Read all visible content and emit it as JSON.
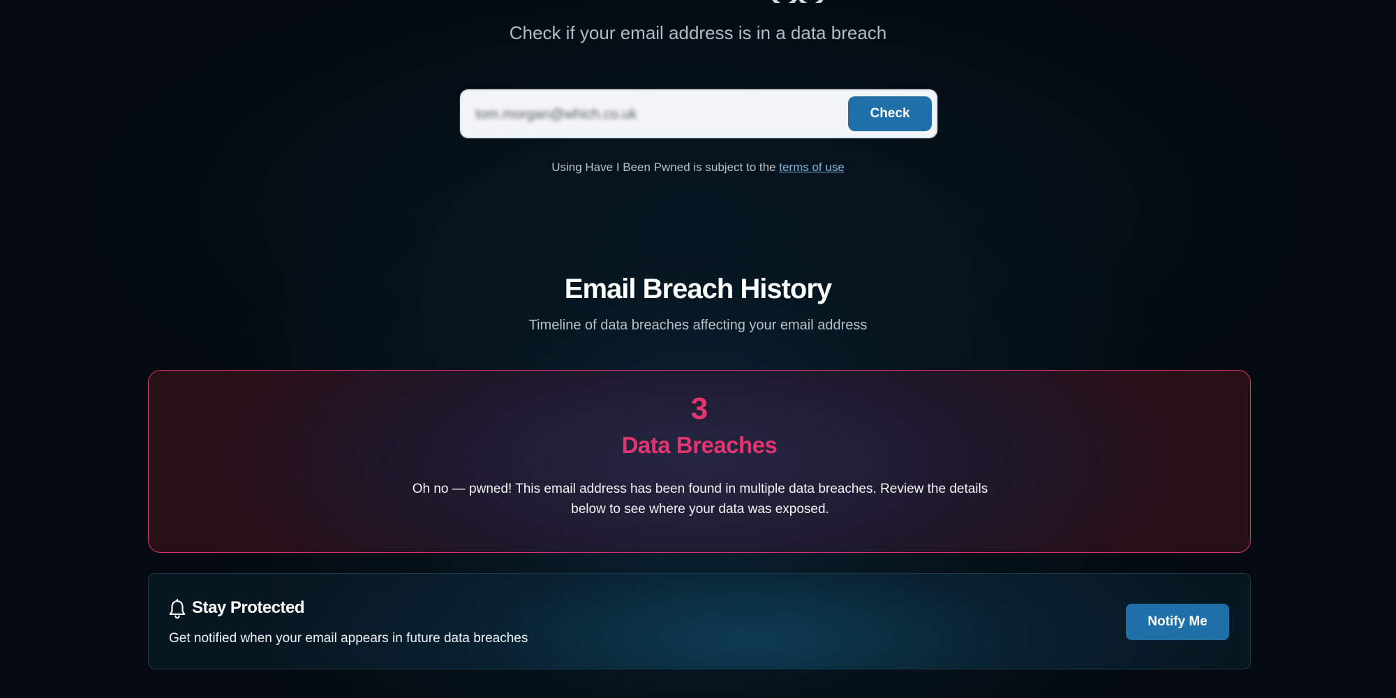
{
  "hero": {
    "subtitle": "Check if your email address is in a data breach"
  },
  "search": {
    "email_value": "tom.morgan@which.co.uk",
    "check_label": "Check"
  },
  "terms": {
    "prefix": "Using Have I Been Pwned is subject to the ",
    "link_label": "terms of use"
  },
  "history": {
    "title": "Email Breach History",
    "subtitle": "Timeline of data breaches affecting your email address"
  },
  "breach_summary": {
    "count": "3",
    "label": "Data Breaches",
    "message": "Oh no — pwned! This email address has been found in multiple data breaches. Review the details below to see where your data was exposed.",
    "accent_color": "#e0356f"
  },
  "protect": {
    "icon": "bell-icon",
    "title": "Stay Protected",
    "description": "Get notified when your email appears in future data breaches",
    "button_label": "Notify Me"
  },
  "colors": {
    "primary_button": "#1f6fa8",
    "link": "#7fb4dc",
    "background": "#040a10"
  }
}
